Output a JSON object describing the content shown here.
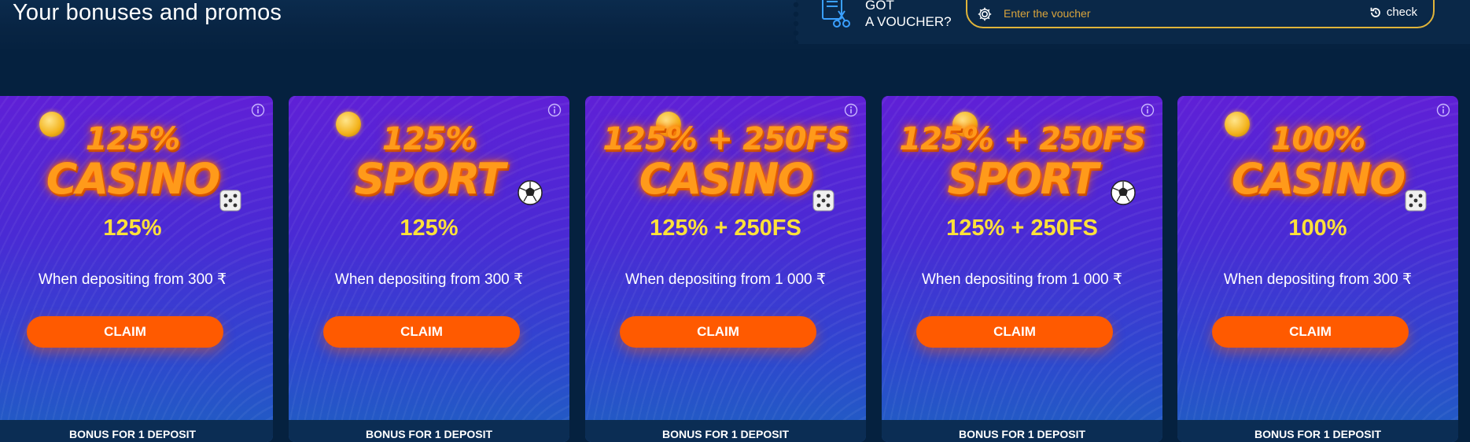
{
  "page": {
    "title": "Your bonuses and promos"
  },
  "voucher": {
    "label_line1": "GOT",
    "label_line2": "A VOUCHER?",
    "placeholder": "Enter the voucher",
    "check_label": "check"
  },
  "colors": {
    "background": "#05213f",
    "claim_button": "#ff5a00",
    "amount_text": "#ffe13a",
    "voucher_border": "#e0b43a"
  },
  "cards": [
    {
      "banner_top": "125%",
      "banner_bottom": "CASINO",
      "decoration": "dice-icon",
      "amount": "125%",
      "description": "When depositing from 300 ₹",
      "claim_label": "CLAIM",
      "footer": "BONUS FOR 1 DEPOSIT"
    },
    {
      "banner_top": "125%",
      "banner_bottom": "SPORT",
      "decoration": "soccer-ball-icon",
      "amount": "125%",
      "description": "When depositing from 300 ₹",
      "claim_label": "CLAIM",
      "footer": "BONUS FOR 1 DEPOSIT"
    },
    {
      "banner_top": "125% + 250FS",
      "banner_bottom": "CASINO",
      "decoration": "dice-icon",
      "amount": "125% + 250FS",
      "description": "When depositing from 1 000 ₹",
      "claim_label": "CLAIM",
      "footer": "BONUS FOR 1 DEPOSIT"
    },
    {
      "banner_top": "125% + 250FS",
      "banner_bottom": "SPORT",
      "decoration": "soccer-ball-icon",
      "amount": "125% + 250FS",
      "description": "When depositing from 1 000 ₹",
      "claim_label": "CLAIM",
      "footer": "BONUS FOR 1 DEPOSIT"
    },
    {
      "banner_top": "100%",
      "banner_bottom": "CASINO",
      "decoration": "dice-icon",
      "amount": "100%",
      "description": "When depositing from 300 ₹",
      "claim_label": "CLAIM",
      "footer": "BONUS FOR 1 DEPOSIT"
    }
  ]
}
